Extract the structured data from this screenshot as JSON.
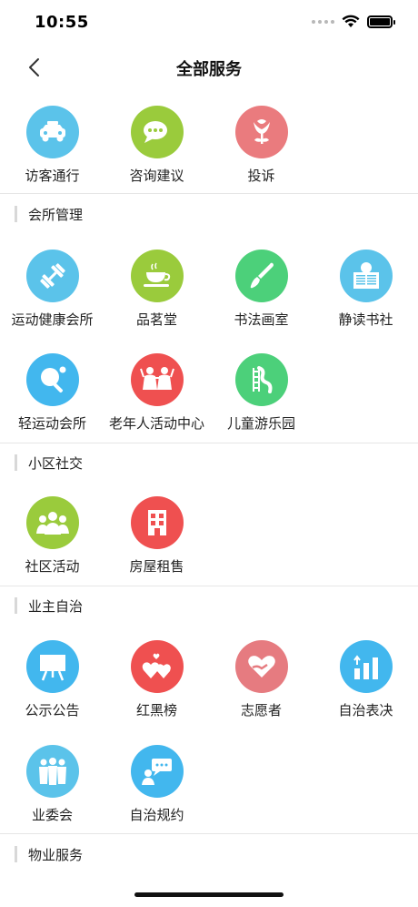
{
  "status_bar": {
    "time": "10:55"
  },
  "nav": {
    "title": "全部服务"
  },
  "top_items": [
    {
      "label": "访客通行",
      "icon": "car-icon",
      "color": "#5bc3ea"
    },
    {
      "label": "咨询建议",
      "icon": "chat-icon",
      "color": "#9acb3c"
    },
    {
      "label": "投诉",
      "icon": "flower-icon",
      "color": "#ea7b7e"
    }
  ],
  "sections": [
    {
      "title": "会所管理",
      "items": [
        {
          "label": "运动健康会所",
          "icon": "dumbbell-icon",
          "color": "#5bc3ea"
        },
        {
          "label": "品茗堂",
          "icon": "teacup-icon",
          "color": "#9acb3c"
        },
        {
          "label": "书法画室",
          "icon": "brush-icon",
          "color": "#4cd07a"
        },
        {
          "label": "静读书社",
          "icon": "newspaper-reader-icon",
          "color": "#5bc3ea"
        },
        {
          "label": "轻运动会所",
          "icon": "ping-pong-icon",
          "color": "#42b7ee"
        },
        {
          "label": "老年人活动中心",
          "icon": "elderly-dancers-icon",
          "color": "#ef5050"
        },
        {
          "label": "儿童游乐园",
          "icon": "slide-icon",
          "color": "#4cd07a"
        }
      ]
    },
    {
      "title": "小区社交",
      "items": [
        {
          "label": "社区活动",
          "icon": "people-group-icon",
          "color": "#9acb3c"
        },
        {
          "label": "房屋租售",
          "icon": "building-icon",
          "color": "#ef5050"
        }
      ]
    },
    {
      "title": "业主自治",
      "items": [
        {
          "label": "公示公告",
          "icon": "notice-board-icon",
          "color": "#42b7ee"
        },
        {
          "label": "红黑榜",
          "icon": "hearts-icon",
          "color": "#ef5050"
        },
        {
          "label": "志愿者",
          "icon": "heart-hand-icon",
          "color": "#e67b80"
        },
        {
          "label": "自治表决",
          "icon": "vote-bars-icon",
          "color": "#42b7ee"
        },
        {
          "label": "业委会",
          "icon": "committee-icon",
          "color": "#5bc3ea"
        },
        {
          "label": "自治规约",
          "icon": "speech-person-icon",
          "color": "#42b7ee"
        }
      ]
    },
    {
      "title": "物业服务",
      "items": []
    }
  ]
}
